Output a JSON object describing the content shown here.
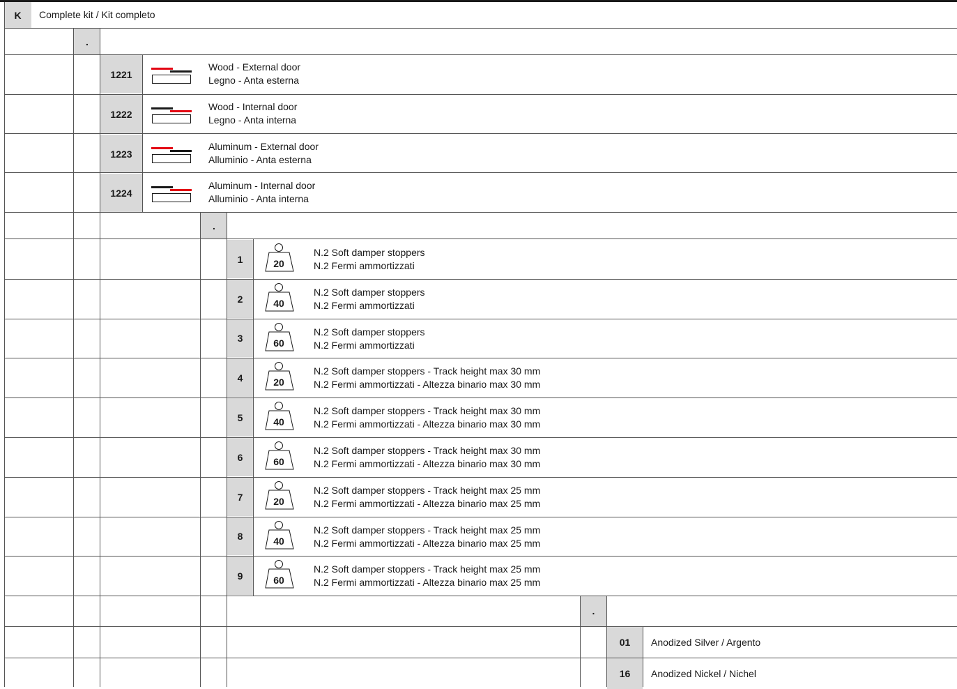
{
  "kit": {
    "code": "K",
    "label": "Complete kit / Kit completo"
  },
  "separators": {
    "level1": ".",
    "level2": ".",
    "level3": "."
  },
  "door_types": [
    {
      "code": "1221",
      "en": "Wood - External door",
      "it": "Legno - Anta esterna",
      "icon": "external-door-icon",
      "red_on": "top"
    },
    {
      "code": "1222",
      "en": "Wood - Internal door",
      "it": "Legno - Anta interna",
      "icon": "internal-door-icon",
      "red_on": "bottom"
    },
    {
      "code": "1223",
      "en": "Aluminum - External door",
      "it": "Alluminio - Anta esterna",
      "icon": "external-door-icon",
      "red_on": "top"
    },
    {
      "code": "1224",
      "en": "Aluminum - Internal door",
      "it": "Alluminio - Anta interna",
      "icon": "internal-door-icon",
      "red_on": "bottom"
    }
  ],
  "stoppers": [
    {
      "code": "1",
      "weight": "20",
      "en": "N.2 Soft damper stoppers",
      "it": "N.2 Fermi ammortizzati"
    },
    {
      "code": "2",
      "weight": "40",
      "en": "N.2 Soft damper stoppers",
      "it": "N.2 Fermi ammortizzati"
    },
    {
      "code": "3",
      "weight": "60",
      "en": "N.2 Soft damper stoppers",
      "it": "N.2 Fermi ammortizzati"
    },
    {
      "code": "4",
      "weight": "20",
      "en": "N.2 Soft damper stoppers - Track height max 30 mm",
      "it": "N.2 Fermi ammortizzati - Altezza binario max 30 mm"
    },
    {
      "code": "5",
      "weight": "40",
      "en": "N.2 Soft damper stoppers - Track height max 30 mm",
      "it": "N.2 Fermi ammortizzati - Altezza binario max 30 mm"
    },
    {
      "code": "6",
      "weight": "60",
      "en": "N.2 Soft damper stoppers - Track height max 30 mm",
      "it": "N.2 Fermi ammortizzati - Altezza binario max 30 mm"
    },
    {
      "code": "7",
      "weight": "20",
      "en": "N.2 Soft damper stoppers - Track height max 25 mm",
      "it": "N.2 Fermi ammortizzati - Altezza binario max 25 mm"
    },
    {
      "code": "8",
      "weight": "40",
      "en": "N.2 Soft damper stoppers - Track height max 25 mm",
      "it": "N.2 Fermi ammortizzati - Altezza binario max 25 mm"
    },
    {
      "code": "9",
      "weight": "60",
      "en": "N.2 Soft damper stoppers - Track height max 25 mm",
      "it": "N.2 Fermi ammortizzati - Altezza binario max 25 mm"
    }
  ],
  "finishes": [
    {
      "code": "01",
      "label": "Anodized Silver / Argento"
    },
    {
      "code": "16",
      "label": "Anodized Nickel / Nichel"
    }
  ],
  "colors": {
    "code_box": "#d9d9d9",
    "accent_red": "#e30613",
    "rule": "#555555",
    "text": "#1a1a1a"
  }
}
